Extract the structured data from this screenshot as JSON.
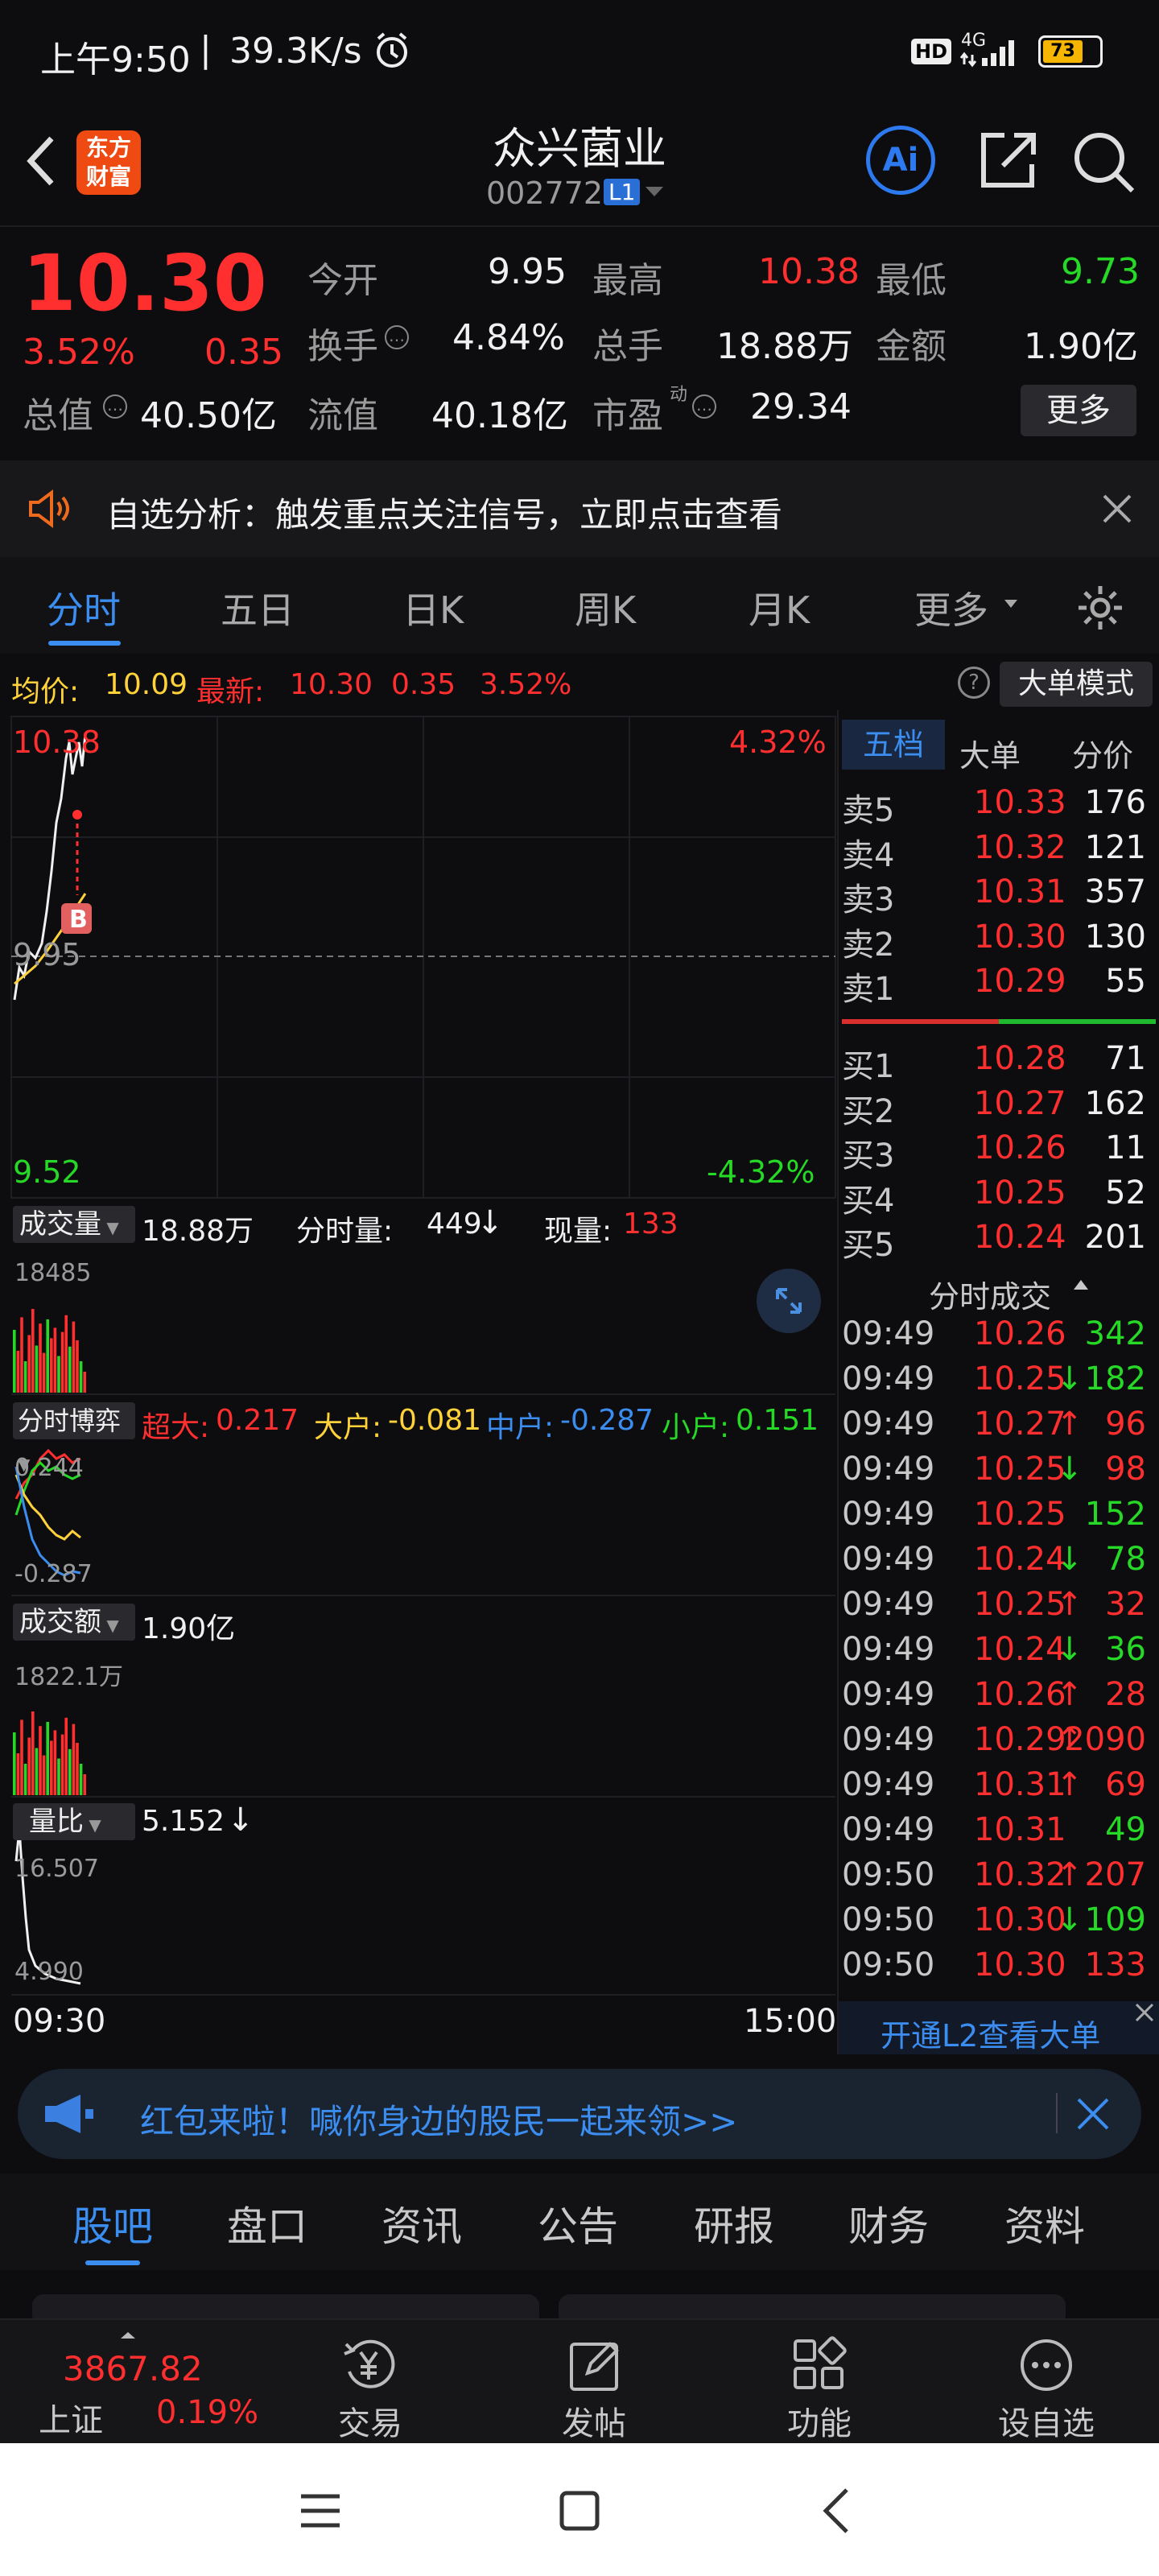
{
  "status_bar": {
    "time": "上午9:50",
    "speed": "39.3K/s",
    "hd": "HD",
    "net": "4G",
    "battery": "73"
  },
  "header": {
    "logo_line1": "东方",
    "logo_line2": "财富",
    "title": "众兴菌业",
    "code": "002772",
    "level": "L1"
  },
  "quote": {
    "price": "10.30",
    "pct": "3.52%",
    "chg": "0.35",
    "open_label": "今开",
    "open": "9.95",
    "high_label": "最高",
    "high": "10.38",
    "low_label": "最低",
    "low": "9.73",
    "turnover_label": "换手",
    "turnover": "4.84%",
    "vol_label": "总手",
    "vol": "18.88万",
    "amt_label": "金额",
    "amt": "1.90亿",
    "mcap_label": "总值",
    "mcap": "40.50亿",
    "fcap_label": "流值",
    "fcap": "40.18亿",
    "pe_label": "市盈",
    "pe_sup": "动",
    "pe": "29.34",
    "more": "更多"
  },
  "banner": {
    "text": "自选分析：触发重点关注信号，立即点击查看"
  },
  "tabs": [
    "分时",
    "五日",
    "日K",
    "周K",
    "月K",
    "更多"
  ],
  "chart_header": {
    "avg_label": "均价:",
    "avg": "10.09",
    "last_label": "最新:",
    "last": "10.30",
    "chg": "0.35",
    "pct": "3.52%",
    "mode": "大单模式"
  },
  "chart_labels": {
    "top_price": "10.38",
    "top_pct": "4.32%",
    "mid_price": "9.95",
    "bot_price": "9.52",
    "bot_pct": "-4.32%",
    "b_marker": "B"
  },
  "volume_panel": {
    "label": "成交量",
    "total": "18.88万",
    "tick_label": "分时量:",
    "tick": "449",
    "arrow": "↓",
    "cur_label": "现量:",
    "cur": "133",
    "max": "18485"
  },
  "game_panel": {
    "label": "分时博弈",
    "super_label": "超大:",
    "super": "0.217",
    "big_label": "大户:",
    "big": "-0.081",
    "mid_label": "中户:",
    "mid": "-0.287",
    "small_label": "小户:",
    "small": "0.151",
    "top": "0.244",
    "bottom": "-0.287"
  },
  "amount_panel": {
    "label": "成交额",
    "total": "1.90亿",
    "max": "1822.1万"
  },
  "ratio_panel": {
    "label": "量比",
    "value": "5.152",
    "arrow": "↓",
    "top": "16.507",
    "bottom": "4.990"
  },
  "time_axis": {
    "start": "09:30",
    "end": "15:00"
  },
  "orderbook": {
    "tabs": [
      "五档",
      "大单",
      "分价"
    ],
    "asks": [
      {
        "l": "卖5",
        "p": "10.33",
        "v": "176"
      },
      {
        "l": "卖4",
        "p": "10.32",
        "v": "121"
      },
      {
        "l": "卖3",
        "p": "10.31",
        "v": "357"
      },
      {
        "l": "卖2",
        "p": "10.30",
        "v": "130"
      },
      {
        "l": "卖1",
        "p": "10.29",
        "v": "55"
      }
    ],
    "bids": [
      {
        "l": "买1",
        "p": "10.28",
        "v": "71"
      },
      {
        "l": "买2",
        "p": "10.27",
        "v": "162"
      },
      {
        "l": "买3",
        "p": "10.26",
        "v": "11"
      },
      {
        "l": "买4",
        "p": "10.25",
        "v": "52"
      },
      {
        "l": "买5",
        "p": "10.24",
        "v": "201"
      }
    ]
  },
  "trades": {
    "title": "分时成交",
    "rows": [
      {
        "t": "09:49",
        "p": "10.26",
        "d": "",
        "v": "342",
        "vc": "green"
      },
      {
        "t": "09:49",
        "p": "10.25",
        "d": "↓",
        "v": "182",
        "vc": "green"
      },
      {
        "t": "09:49",
        "p": "10.27",
        "d": "↑",
        "v": "96",
        "vc": "red"
      },
      {
        "t": "09:49",
        "p": "10.25",
        "d": "↓",
        "v": "98",
        "vc": "red"
      },
      {
        "t": "09:49",
        "p": "10.25",
        "d": "",
        "v": "152",
        "vc": "green"
      },
      {
        "t": "09:49",
        "p": "10.24",
        "d": "↓",
        "v": "78",
        "vc": "green"
      },
      {
        "t": "09:49",
        "p": "10.25",
        "d": "↑",
        "v": "32",
        "vc": "red"
      },
      {
        "t": "09:49",
        "p": "10.24",
        "d": "↓",
        "v": "36",
        "vc": "green"
      },
      {
        "t": "09:49",
        "p": "10.26",
        "d": "↑",
        "v": "28",
        "vc": "red"
      },
      {
        "t": "09:49",
        "p": "10.29",
        "d": "↑",
        "v": "2090",
        "vc": "red"
      },
      {
        "t": "09:49",
        "p": "10.31",
        "d": "↑",
        "v": "69",
        "vc": "red"
      },
      {
        "t": "09:49",
        "p": "10.31",
        "d": "",
        "v": "49",
        "vc": "green"
      },
      {
        "t": "09:50",
        "p": "10.32",
        "d": "↑",
        "v": "207",
        "vc": "red"
      },
      {
        "t": "09:50",
        "p": "10.30",
        "d": "↓",
        "v": "109",
        "vc": "green"
      },
      {
        "t": "09:50",
        "p": "10.30",
        "d": "",
        "v": "133",
        "vc": "red"
      }
    ],
    "l2": "开通L2查看大单"
  },
  "promo": {
    "text": "红包来啦！喊你身边的股民一起来领>>"
  },
  "sub_tabs": [
    "股吧",
    "盘口",
    "资讯",
    "公告",
    "研报",
    "财务",
    "资料"
  ],
  "dock": {
    "index_value": "3867.82",
    "index_name": "上证",
    "index_pct": "0.19%",
    "trade": "交易",
    "post": "发帖",
    "func": "功能",
    "watch": "设自选"
  }
}
